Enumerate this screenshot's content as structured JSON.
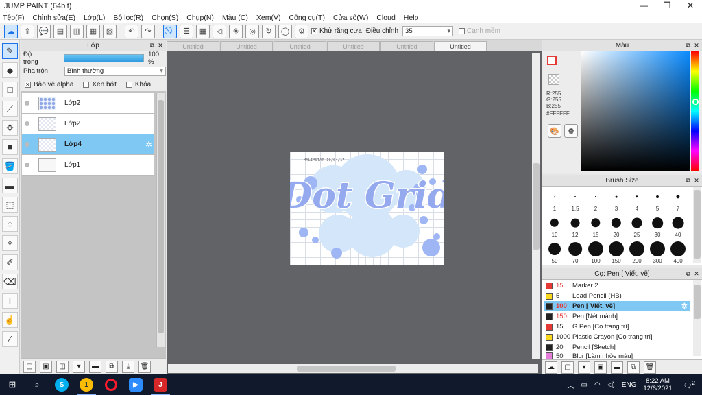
{
  "window": {
    "title": "JUMP PAINT (64bit)",
    "controls": [
      "—",
      "❐",
      "✕"
    ]
  },
  "menu": [
    "Tệp(F)",
    "Chỉnh sửa(E)",
    "Lớp(L)",
    "Bộ lọc(R)",
    "Chọn(S)",
    "Chụp(N)",
    "Màu (C)",
    "Xem(V)",
    "Công cụ(T)",
    "Cửa sổ(W)",
    "Cloud",
    "Help"
  ],
  "toolbar": {
    "antialias_label": "Khử răng cưa",
    "adjust_label": "Điều chỉnh",
    "adjust_value": "35",
    "smooth_label": "Cạnh mềm"
  },
  "layer_panel": {
    "title": "Lớp",
    "opacity_label": "Độ trong",
    "opacity_value": "100 %",
    "blend_label": "Pha trộn",
    "blend_value": "Bình thường",
    "protect_alpha": "Bảo vệ alpha",
    "clip": "Xén bớt",
    "lock": "Khóa",
    "layers": [
      {
        "name": "Lớp2"
      },
      {
        "name": "Lớp2"
      },
      {
        "name": "Lớp4"
      },
      {
        "name": "Lớp1"
      }
    ]
  },
  "tabs": [
    "Untitled",
    "Untitled",
    "Untitled",
    "Untitled",
    "Untitled",
    "Untitled"
  ],
  "canvas": {
    "artwork_text": "Dot Grid",
    "small_note": "MALIMSTAR 10/04/17"
  },
  "color_panel": {
    "title": "Màu",
    "r": "R:255",
    "g": "G:255",
    "b": "B:255",
    "hex": "#FFFFFF",
    "fg_color": "#ffffff",
    "accent": "#0a8bff"
  },
  "brush_size_panel": {
    "title": "Brush Size",
    "sizes": [
      "1",
      "1.5",
      "2",
      "3",
      "4",
      "5",
      "7",
      "10",
      "12",
      "15",
      "20",
      "25",
      "30",
      "40",
      "50",
      "70",
      "100",
      "150",
      "200",
      "300",
      "400"
    ]
  },
  "brush_list_panel": {
    "title": "Cọ: Pen [ Viết, vẽ]",
    "brushes": [
      {
        "size": "15",
        "name": "Marker 2",
        "color": "#e53935"
      },
      {
        "size": "5",
        "name": "Lead Pencil (HB)",
        "color": "#f9d71c"
      },
      {
        "size": "100",
        "name": "Pen [ Viết, vẽ]",
        "color": "#222222"
      },
      {
        "size": "150",
        "name": "Pen [Nét mảnh]",
        "color": "#222222"
      },
      {
        "size": "15",
        "name": "G Pen [Cọ trang trí]",
        "color": "#e53935"
      },
      {
        "size": "1000",
        "name": "Plastic Crayon [Cọ trang trí]",
        "color": "#f9d71c"
      },
      {
        "size": "20",
        "name": "Pencil [Sketch]",
        "color": "#222222"
      },
      {
        "size": "50",
        "name": "Blur [Làm nhòe màu]",
        "color": "#e57edb"
      }
    ]
  },
  "taskbar": {
    "lang": "ENG",
    "time": "8:22 AM",
    "date": "12/6/2021",
    "badge": "1",
    "notif": "2"
  }
}
